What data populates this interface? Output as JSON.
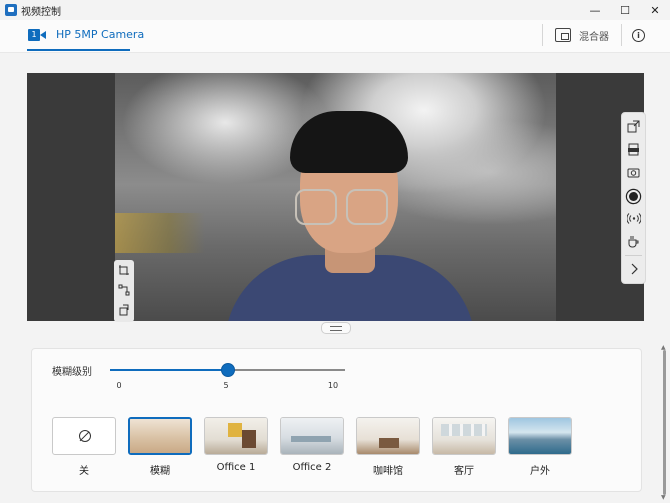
{
  "window": {
    "title": "视频控制",
    "minimize_glyph": "—",
    "maximize_glyph": "☐",
    "close_glyph": "✕"
  },
  "header": {
    "camera_index": "1",
    "camera_name": "HP 5MP Camera",
    "mixer_label": "混合器",
    "info_glyph": "i"
  },
  "blur": {
    "label": "模糊级别",
    "min": 0,
    "max": 10,
    "value": 5,
    "ticks": [
      "0",
      "5",
      "10"
    ]
  },
  "backgrounds": [
    {
      "label": "关",
      "selected": false
    },
    {
      "label": "模糊",
      "selected": true
    },
    {
      "label": "Office 1",
      "selected": false
    },
    {
      "label": "Office 2",
      "selected": false
    },
    {
      "label": "咖啡馆",
      "selected": false
    },
    {
      "label": "客厅",
      "selected": false
    },
    {
      "label": "户外",
      "selected": false
    }
  ],
  "icons": {
    "left_tools": [
      "crop-icon",
      "adjust-points-icon",
      "rotate-icon"
    ],
    "right_tools": [
      "expand-icon",
      "pdf-icon",
      "camera-capture-icon",
      "record-icon",
      "broadcast-icon",
      "coffee-icon",
      "chevron-right-icon"
    ]
  },
  "colors": {
    "accent": "#0f6cbd"
  }
}
